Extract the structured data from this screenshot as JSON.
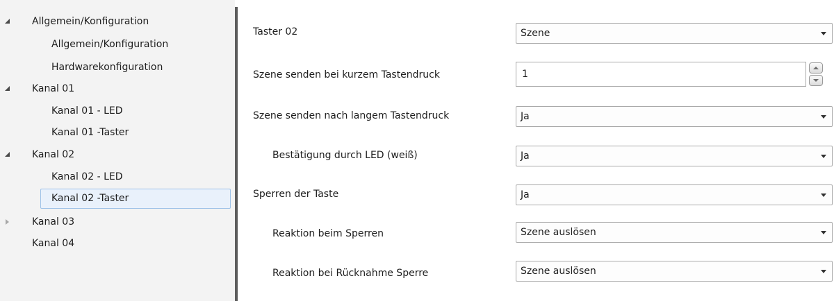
{
  "tree": {
    "items": [
      {
        "label": "Allgemein/Konfiguration",
        "expander": "expanded"
      },
      {
        "label": "Allgemein/Konfiguration",
        "expander": "none"
      },
      {
        "label": "Hardwarekonfiguration",
        "expander": "none"
      },
      {
        "label": "Kanal 01",
        "expander": "expanded"
      },
      {
        "label": "Kanal 01 - LED",
        "expander": "none"
      },
      {
        "label": "Kanal 01 -Taster",
        "expander": "none"
      },
      {
        "label": "Kanal 02",
        "expander": "expanded"
      },
      {
        "label": "Kanal 02 - LED",
        "expander": "none"
      },
      {
        "label": "Kanal 02 -Taster",
        "expander": "none",
        "selected": true
      },
      {
        "label": "Kanal 03",
        "expander": "collapsed"
      },
      {
        "label": "Kanal 04",
        "expander": "none"
      }
    ]
  },
  "form": {
    "rows": [
      {
        "label": "Taster 02",
        "type": "select",
        "value": "Szene"
      },
      {
        "label": "Szene senden bei kurzem Tastendruck",
        "type": "number",
        "value": "1"
      },
      {
        "label": "Szene senden nach langem Tastendruck",
        "type": "select",
        "value": "Ja"
      },
      {
        "label": "Bestätigung durch LED (weiß)",
        "type": "select",
        "value": "Ja"
      },
      {
        "label": "Sperren der Taste",
        "type": "select",
        "value": "Ja"
      },
      {
        "label": "Reaktion beim Sperren",
        "type": "select",
        "value": "Szene auslösen"
      },
      {
        "label": "Reaktion bei Rücknahme Sperre",
        "type": "select",
        "value": "Szene auslösen"
      }
    ]
  },
  "colors": {
    "tree_background": "#f3f3f3",
    "selection_background": "#e9f1fb",
    "selection_border": "#9ec2e8",
    "splitter": "#5c5c5c",
    "control_border": "#a9a9a9"
  }
}
